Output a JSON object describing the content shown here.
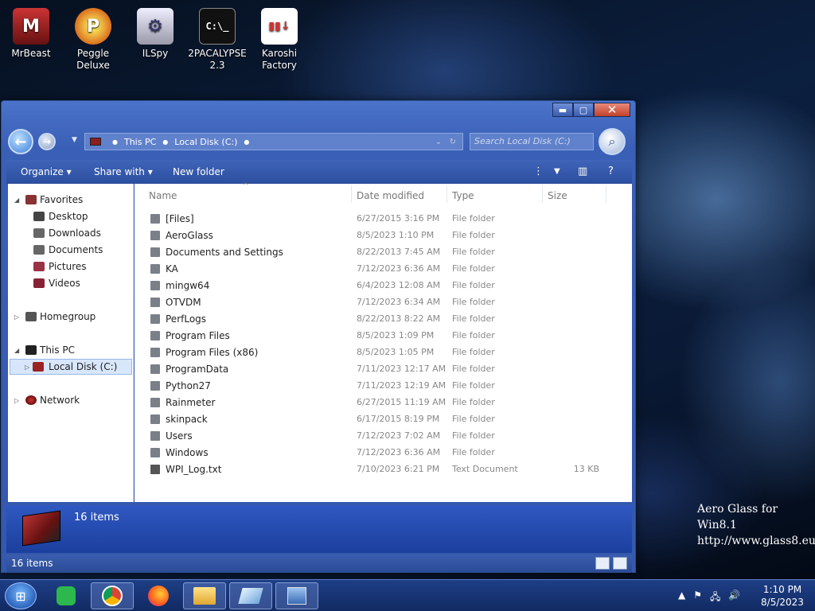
{
  "desktop": {
    "icons": [
      {
        "label": "MrBeast"
      },
      {
        "label": "Peggle Deluxe"
      },
      {
        "label": "ILSpy"
      },
      {
        "label": "2PACALYPSE 2.3"
      },
      {
        "label": "Karoshi Factory"
      }
    ],
    "watermark_line1": "Aero Glass for Win8.1",
    "watermark_line2": "http://www.glass8.eu"
  },
  "window": {
    "address": {
      "crumbs": [
        "This PC",
        "Local Disk (C:)"
      ],
      "search_placeholder": "Search Local Disk (C:)"
    },
    "toolbar": {
      "organize": "Organize",
      "share_with": "Share with",
      "new_folder": "New folder"
    },
    "nav": {
      "favorites": "Favorites",
      "desktop": "Desktop",
      "downloads": "Downloads",
      "documents": "Documents",
      "pictures": "Pictures",
      "videos": "Videos",
      "homegroup": "Homegroup",
      "this_pc": "This PC",
      "local_disk": "Local Disk (C:)",
      "network": "Network"
    },
    "columns": {
      "name": "Name",
      "date": "Date modified",
      "type": "Type",
      "size": "Size"
    },
    "files": [
      {
        "name": "[Files]",
        "date": "6/27/2015 3:16 PM",
        "type": "File folder",
        "size": ""
      },
      {
        "name": "AeroGlass",
        "date": "8/5/2023 1:10 PM",
        "type": "File folder",
        "size": ""
      },
      {
        "name": "Documents and Settings",
        "date": "8/22/2013 7:45 AM",
        "type": "File folder",
        "size": ""
      },
      {
        "name": "KA",
        "date": "7/12/2023 6:36 AM",
        "type": "File folder",
        "size": ""
      },
      {
        "name": "mingw64",
        "date": "6/4/2023 12:08 AM",
        "type": "File folder",
        "size": ""
      },
      {
        "name": "OTVDM",
        "date": "7/12/2023 6:34 AM",
        "type": "File folder",
        "size": ""
      },
      {
        "name": "PerfLogs",
        "date": "8/22/2013 8:22 AM",
        "type": "File folder",
        "size": ""
      },
      {
        "name": "Program Files",
        "date": "8/5/2023 1:09 PM",
        "type": "File folder",
        "size": ""
      },
      {
        "name": "Program Files (x86)",
        "date": "8/5/2023 1:05 PM",
        "type": "File folder",
        "size": ""
      },
      {
        "name": "ProgramData",
        "date": "7/11/2023 12:17 AM",
        "type": "File folder",
        "size": ""
      },
      {
        "name": "Python27",
        "date": "7/11/2023 12:19 AM",
        "type": "File folder",
        "size": ""
      },
      {
        "name": "Rainmeter",
        "date": "6/27/2015 11:19 AM",
        "type": "File folder",
        "size": ""
      },
      {
        "name": "skinpack",
        "date": "6/17/2015 8:19 PM",
        "type": "File folder",
        "size": ""
      },
      {
        "name": "Users",
        "date": "7/12/2023 7:02 AM",
        "type": "File folder",
        "size": ""
      },
      {
        "name": "Windows",
        "date": "7/12/2023 6:36 AM",
        "type": "File folder",
        "size": ""
      },
      {
        "name": "WPI_Log.txt",
        "date": "7/10/2023 6:21 PM",
        "type": "Text Document",
        "size": "13 KB"
      }
    ],
    "details_count": "16 items",
    "status_count": "16 items"
  },
  "taskbar": {
    "clock_time": "1:10 PM",
    "clock_date": "8/5/2023"
  },
  "colors": {
    "accent": "#2f58c1",
    "folder_icon": "#7a7f88",
    "selected_bg": "#d8e6fb"
  }
}
